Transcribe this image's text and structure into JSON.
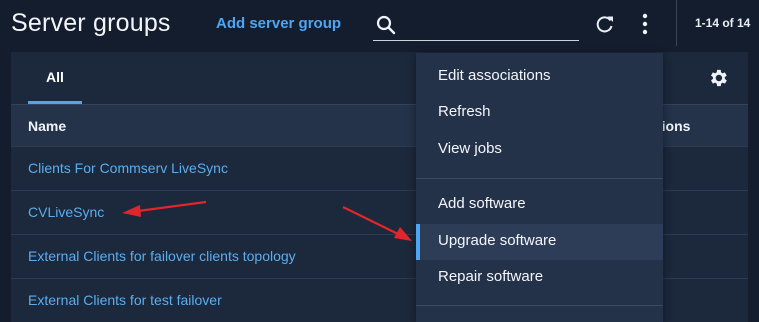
{
  "header": {
    "title": "Server groups",
    "add_link": "Add server group",
    "search_placeholder": "",
    "range": "1-14 of 14"
  },
  "tabs": [
    {
      "label": "All"
    }
  ],
  "table": {
    "columns": [
      "Name",
      "Actions"
    ],
    "column_actions_visible": "tions",
    "rows": [
      {
        "name": "Clients For Commserv LiveSync"
      },
      {
        "name": "CVLiveSync"
      },
      {
        "name": "External Clients for failover clients topology"
      },
      {
        "name": "External Clients for test failover"
      }
    ]
  },
  "menu": {
    "group1": [
      "Edit associations",
      "Refresh",
      "View jobs"
    ],
    "group2": [
      "Add software",
      "Upgrade software",
      "Repair software"
    ],
    "active": "Upgrade software"
  },
  "colors": {
    "accent": "#4ea6f2",
    "link": "#5aaef0",
    "background": "#141d2d",
    "annotation_arrow": "#e0262b"
  },
  "icons": [
    "search-icon",
    "refresh-icon",
    "kebab-menu-icon",
    "gear-icon",
    "arrow-annotation"
  ]
}
